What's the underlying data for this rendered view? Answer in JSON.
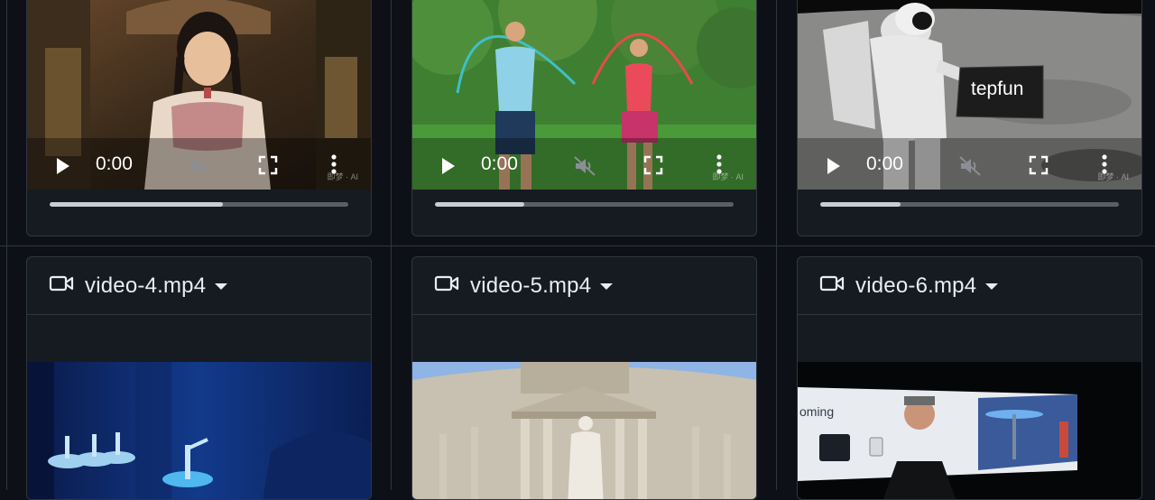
{
  "videos_top": [
    {
      "time": "0:00",
      "progress": 0.58,
      "watermark": "即梦 · AI"
    },
    {
      "time": "0:00",
      "progress": 0.3,
      "watermark": "即梦 · AI"
    },
    {
      "time": "0:00",
      "progress": 0.27,
      "watermark": "即梦 · AI",
      "laptop_text": "tepfun"
    }
  ],
  "videos_bottom": [
    {
      "file_name": "video-4.mp4"
    },
    {
      "file_name": "video-5.mp4"
    },
    {
      "file_name": "video-6.mp4",
      "screen_text": "oming"
    }
  ],
  "icons": {
    "file": "video-camera-icon",
    "dropdown": "caret-down-icon",
    "play": "play-icon",
    "mute": "volume-mute-icon",
    "fullscreen": "fullscreen-icon",
    "more": "more-vertical-icon"
  },
  "colors": {
    "background": "#0d1117",
    "card": "#161b22",
    "border": "#30363d",
    "text": "#e6edf3"
  }
}
